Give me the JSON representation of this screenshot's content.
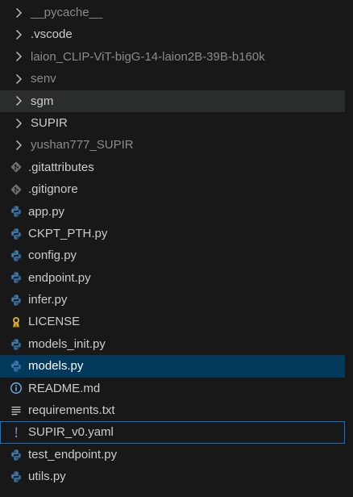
{
  "explorer": {
    "items": [
      {
        "label": "__pycache__",
        "kind": "folder",
        "dim": true,
        "icon": "chevron-right-icon"
      },
      {
        "label": ".vscode",
        "kind": "folder",
        "dim": false,
        "icon": "chevron-right-icon"
      },
      {
        "label": "laion_CLIP-ViT-bigG-14-laion2B-39B-b160k",
        "kind": "folder",
        "dim": true,
        "icon": "chevron-right-icon"
      },
      {
        "label": "senv",
        "kind": "folder",
        "dim": true,
        "icon": "chevron-right-icon"
      },
      {
        "label": "sgm",
        "kind": "folder",
        "dim": false,
        "icon": "chevron-right-icon",
        "state": "hovered"
      },
      {
        "label": "SUPIR",
        "kind": "folder",
        "dim": false,
        "icon": "chevron-right-icon"
      },
      {
        "label": "yushan777_SUPIR",
        "kind": "folder",
        "dim": true,
        "icon": "chevron-right-icon"
      },
      {
        "label": ".gitattributes",
        "kind": "file",
        "dim": false,
        "icon": "git-icon"
      },
      {
        "label": ".gitignore",
        "kind": "file",
        "dim": false,
        "icon": "git-icon"
      },
      {
        "label": "app.py",
        "kind": "file",
        "dim": false,
        "icon": "python-icon"
      },
      {
        "label": "CKPT_PTH.py",
        "kind": "file",
        "dim": false,
        "icon": "python-icon"
      },
      {
        "label": "config.py",
        "kind": "file",
        "dim": false,
        "icon": "python-icon"
      },
      {
        "label": "endpoint.py",
        "kind": "file",
        "dim": false,
        "icon": "python-icon"
      },
      {
        "label": "infer.py",
        "kind": "file",
        "dim": false,
        "icon": "python-icon"
      },
      {
        "label": "LICENSE",
        "kind": "file",
        "dim": false,
        "icon": "license-icon"
      },
      {
        "label": "models_init.py",
        "kind": "file",
        "dim": false,
        "icon": "python-icon"
      },
      {
        "label": "models.py",
        "kind": "file",
        "dim": false,
        "icon": "python-icon",
        "state": "selected"
      },
      {
        "label": "README.md",
        "kind": "file",
        "dim": false,
        "icon": "info-icon"
      },
      {
        "label": "requirements.txt",
        "kind": "file",
        "dim": false,
        "icon": "text-lines-icon"
      },
      {
        "label": "SUPIR_v0.yaml",
        "kind": "file",
        "dim": false,
        "icon": "exclamation-icon",
        "state": "focused"
      },
      {
        "label": "test_endpoint.py",
        "kind": "file",
        "dim": false,
        "icon": "python-icon"
      },
      {
        "label": "utils.py",
        "kind": "file",
        "dim": false,
        "icon": "python-icon"
      }
    ]
  },
  "colors": {
    "background": "#181818",
    "hover": "#2a2d2e",
    "selected": "#04395e",
    "focus_border": "#0078d4",
    "text": "#cccccc",
    "text_dim": "#8b8b8b",
    "python_blue": "#3c78aa",
    "python_yellow": "#e5c74a",
    "git_gray": "#6d6d6d",
    "license_yellow": "#d5ab2a",
    "info_blue": "#75beff",
    "yaml_purple": "#a074c4"
  }
}
